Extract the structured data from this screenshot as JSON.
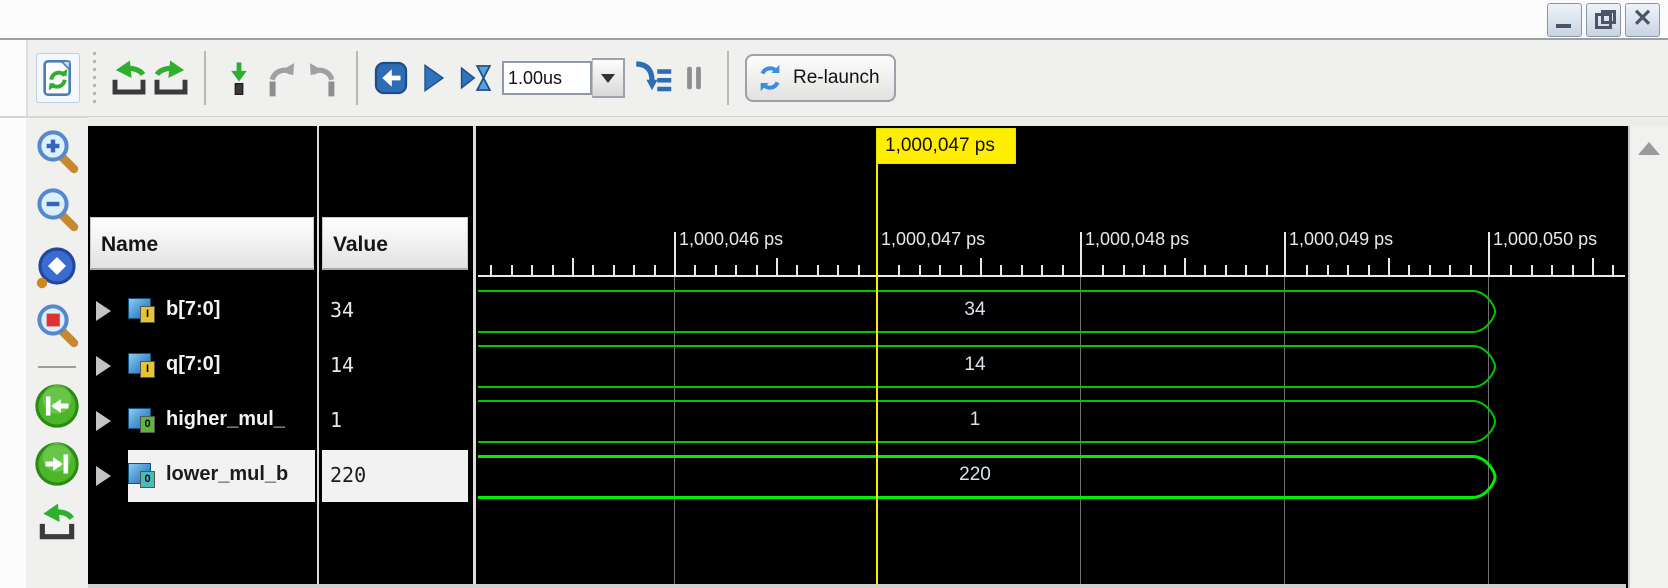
{
  "window": {
    "controls": [
      {
        "name": "minimize"
      },
      {
        "name": "restore"
      },
      {
        "name": "close"
      }
    ]
  },
  "toolbar": {
    "items": [
      {
        "kind": "icon",
        "name": "refresh",
        "boxed": true
      },
      {
        "kind": "handle"
      },
      {
        "kind": "icon",
        "name": "back"
      },
      {
        "kind": "icon",
        "name": "forward"
      },
      {
        "kind": "sep"
      },
      {
        "kind": "icon",
        "name": "goto-time"
      },
      {
        "kind": "icon",
        "name": "undo"
      },
      {
        "kind": "icon",
        "name": "redo"
      },
      {
        "kind": "sep"
      },
      {
        "kind": "icon",
        "name": "restart"
      },
      {
        "kind": "icon",
        "name": "run-all"
      },
      {
        "kind": "icon",
        "name": "run-for"
      },
      {
        "kind": "time-input"
      },
      {
        "kind": "icon",
        "name": "step"
      },
      {
        "kind": "icon",
        "name": "break"
      },
      {
        "kind": "sep"
      },
      {
        "kind": "relaunch"
      }
    ],
    "time_input": {
      "value": "1.00us"
    },
    "relaunch_label": "Re-launch"
  },
  "sidebar": {
    "items": [
      {
        "kind": "icon",
        "name": "zoom-in"
      },
      {
        "kind": "icon",
        "name": "zoom-out"
      },
      {
        "kind": "icon",
        "name": "zoom-fit"
      },
      {
        "kind": "icon",
        "name": "zoom-area"
      },
      {
        "kind": "sep"
      },
      {
        "kind": "icon",
        "name": "prev-transition"
      },
      {
        "kind": "icon",
        "name": "next-transition"
      },
      {
        "kind": "icon",
        "name": "goto-start"
      }
    ]
  },
  "wave": {
    "columns": {
      "name": "Name",
      "value": "Value"
    },
    "signals": [
      {
        "name": "b[7:0]",
        "value": "34",
        "badge": "I",
        "badge_color": "#e8c332",
        "selected": false
      },
      {
        "name": "q[7:0]",
        "value": "14",
        "badge": "I",
        "badge_color": "#e8c332",
        "selected": false
      },
      {
        "name": "higher_mul_",
        "value": "1",
        "badge": "0",
        "badge_color": "#5cb83c",
        "selected": false
      },
      {
        "name": "lower_mul_b",
        "value": "220",
        "badge": "0",
        "badge_color": "#49bdb4",
        "selected": true
      }
    ],
    "cursor": {
      "label": "1,000,047 ps"
    },
    "ruler": {
      "ticks": [
        "1,000,046 ps",
        "1,000,047 ps",
        "1,000,048 ps",
        "1,000,049 ps",
        "1,000,050 ps"
      ]
    },
    "colors": {
      "wave_green": "#00c800",
      "selected_green": "#00ee00",
      "cursor_yellow": "#ffee00",
      "grid_gray": "#6f6f6f"
    }
  }
}
